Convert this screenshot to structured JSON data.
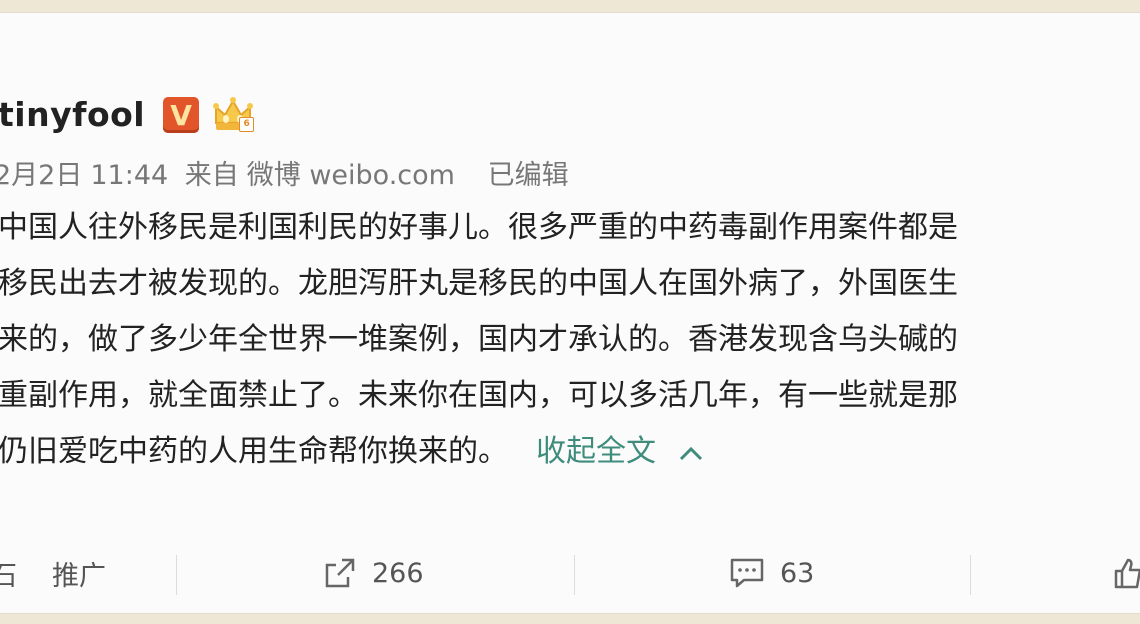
{
  "post": {
    "username": "tinyfool",
    "verified_badge": "V",
    "vip_badge_level": "6",
    "meta": {
      "date": "2月2日",
      "time": "11:44",
      "source_prefix": "来自",
      "source": "微博 weibo.com",
      "edited": "已编辑"
    },
    "content_lines": [
      "中国人往外移民是利国利民的好事儿。很多严重的中药毒副作用案件都是",
      "移民出去才被发现的。龙胆泻肝丸是移民的中国人在国外病了，外国医生",
      "来的，做了多少年全世界一堆案例，国内才承认的。香港发现含乌头碱的",
      "重副作用，就全面禁止了。未来你在国内，可以多活几年，有一些就是那",
      "仍旧爱吃中药的人用生命帮你换来的。"
    ],
    "collapse_label": "收起全文",
    "caret": "^"
  },
  "actions": {
    "left_edge_text": "石",
    "promote_label": "推广",
    "repost_count": "266",
    "comment_count": "63"
  },
  "colors": {
    "background": "#efe7d6",
    "card": "#fbfbfb",
    "link_green": "#3f8c7c",
    "vbadge": "#e2552b"
  }
}
